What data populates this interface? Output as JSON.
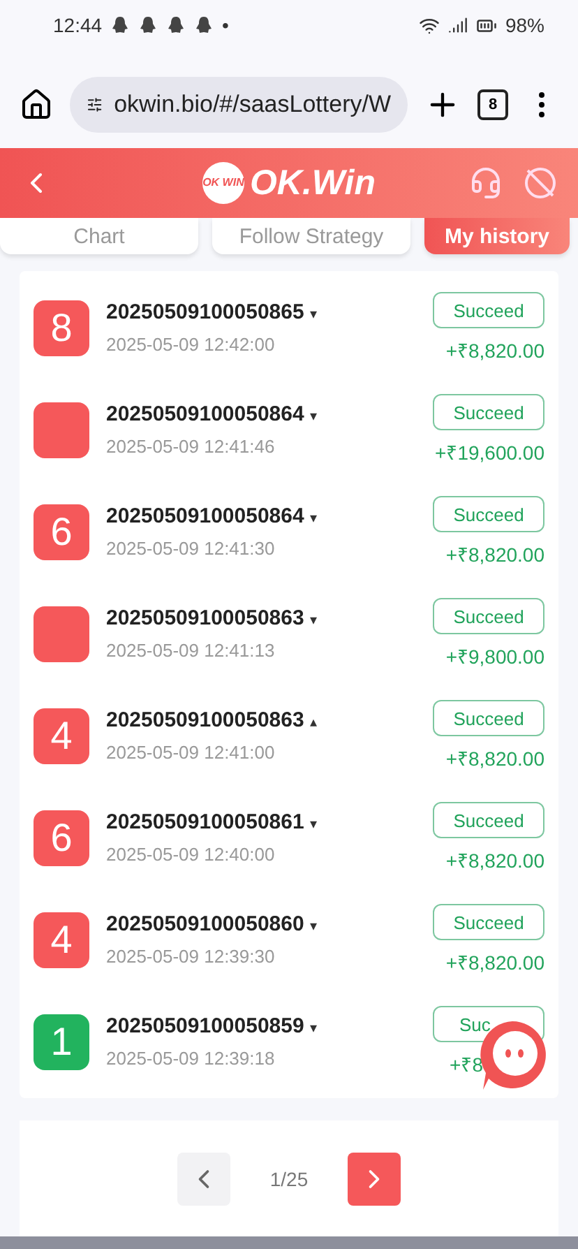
{
  "status_bar": {
    "time": "12:44",
    "dot": "•",
    "battery": "98%"
  },
  "browser": {
    "url": "okwin.bio/#/saasLottery/W",
    "tab_count": "8"
  },
  "header": {
    "logo_badge": "OK WIN",
    "logo_text": "OK.Win"
  },
  "tabs": [
    {
      "label": "Chart",
      "selected": false
    },
    {
      "label": "Follow Strategy",
      "selected": false
    },
    {
      "label": "My history",
      "selected": true
    }
  ],
  "rows": [
    {
      "number": "8",
      "color": "#f5585a",
      "period": "20250509100050865",
      "caret": "▾",
      "time": "2025-05-09 12:42:00",
      "status": "Succeed",
      "amount": "+₹8,820.00"
    },
    {
      "color": "#f5585a",
      "period": "20250509100050864",
      "caret": "▾",
      "time": "2025-05-09 12:41:46",
      "status": "Succeed",
      "amount": "+₹19,600.00"
    },
    {
      "number": "6",
      "color": "#f5585a",
      "period": "20250509100050864",
      "caret": "▾",
      "time": "2025-05-09 12:41:30",
      "status": "Succeed",
      "amount": "+₹8,820.00"
    },
    {
      "color": "#f5585a",
      "period": "20250509100050863",
      "caret": "▾",
      "time": "2025-05-09 12:41:13",
      "status": "Succeed",
      "amount": "+₹9,800.00"
    },
    {
      "number": "4",
      "color": "#f5585a",
      "period": "20250509100050863",
      "caret": "▴",
      "time": "2025-05-09 12:41:00",
      "status": "Succeed",
      "amount": "+₹8,820.00"
    },
    {
      "number": "6",
      "color": "#f5585a",
      "period": "20250509100050861",
      "caret": "▾",
      "time": "2025-05-09 12:40:00",
      "status": "Succeed",
      "amount": "+₹8,820.00"
    },
    {
      "number": "4",
      "color": "#f5585a",
      "period": "20250509100050860",
      "caret": "▾",
      "time": "2025-05-09 12:39:30",
      "status": "Succeed",
      "amount": "+₹8,820.00"
    },
    {
      "number": "1",
      "color": "#22b35e",
      "period": "20250509100050859",
      "caret": "▾",
      "time": "2025-05-09 12:39:18",
      "status": "Suc",
      "amount": "+₹8"
    }
  ],
  "pagination": {
    "page": "1/25"
  }
}
